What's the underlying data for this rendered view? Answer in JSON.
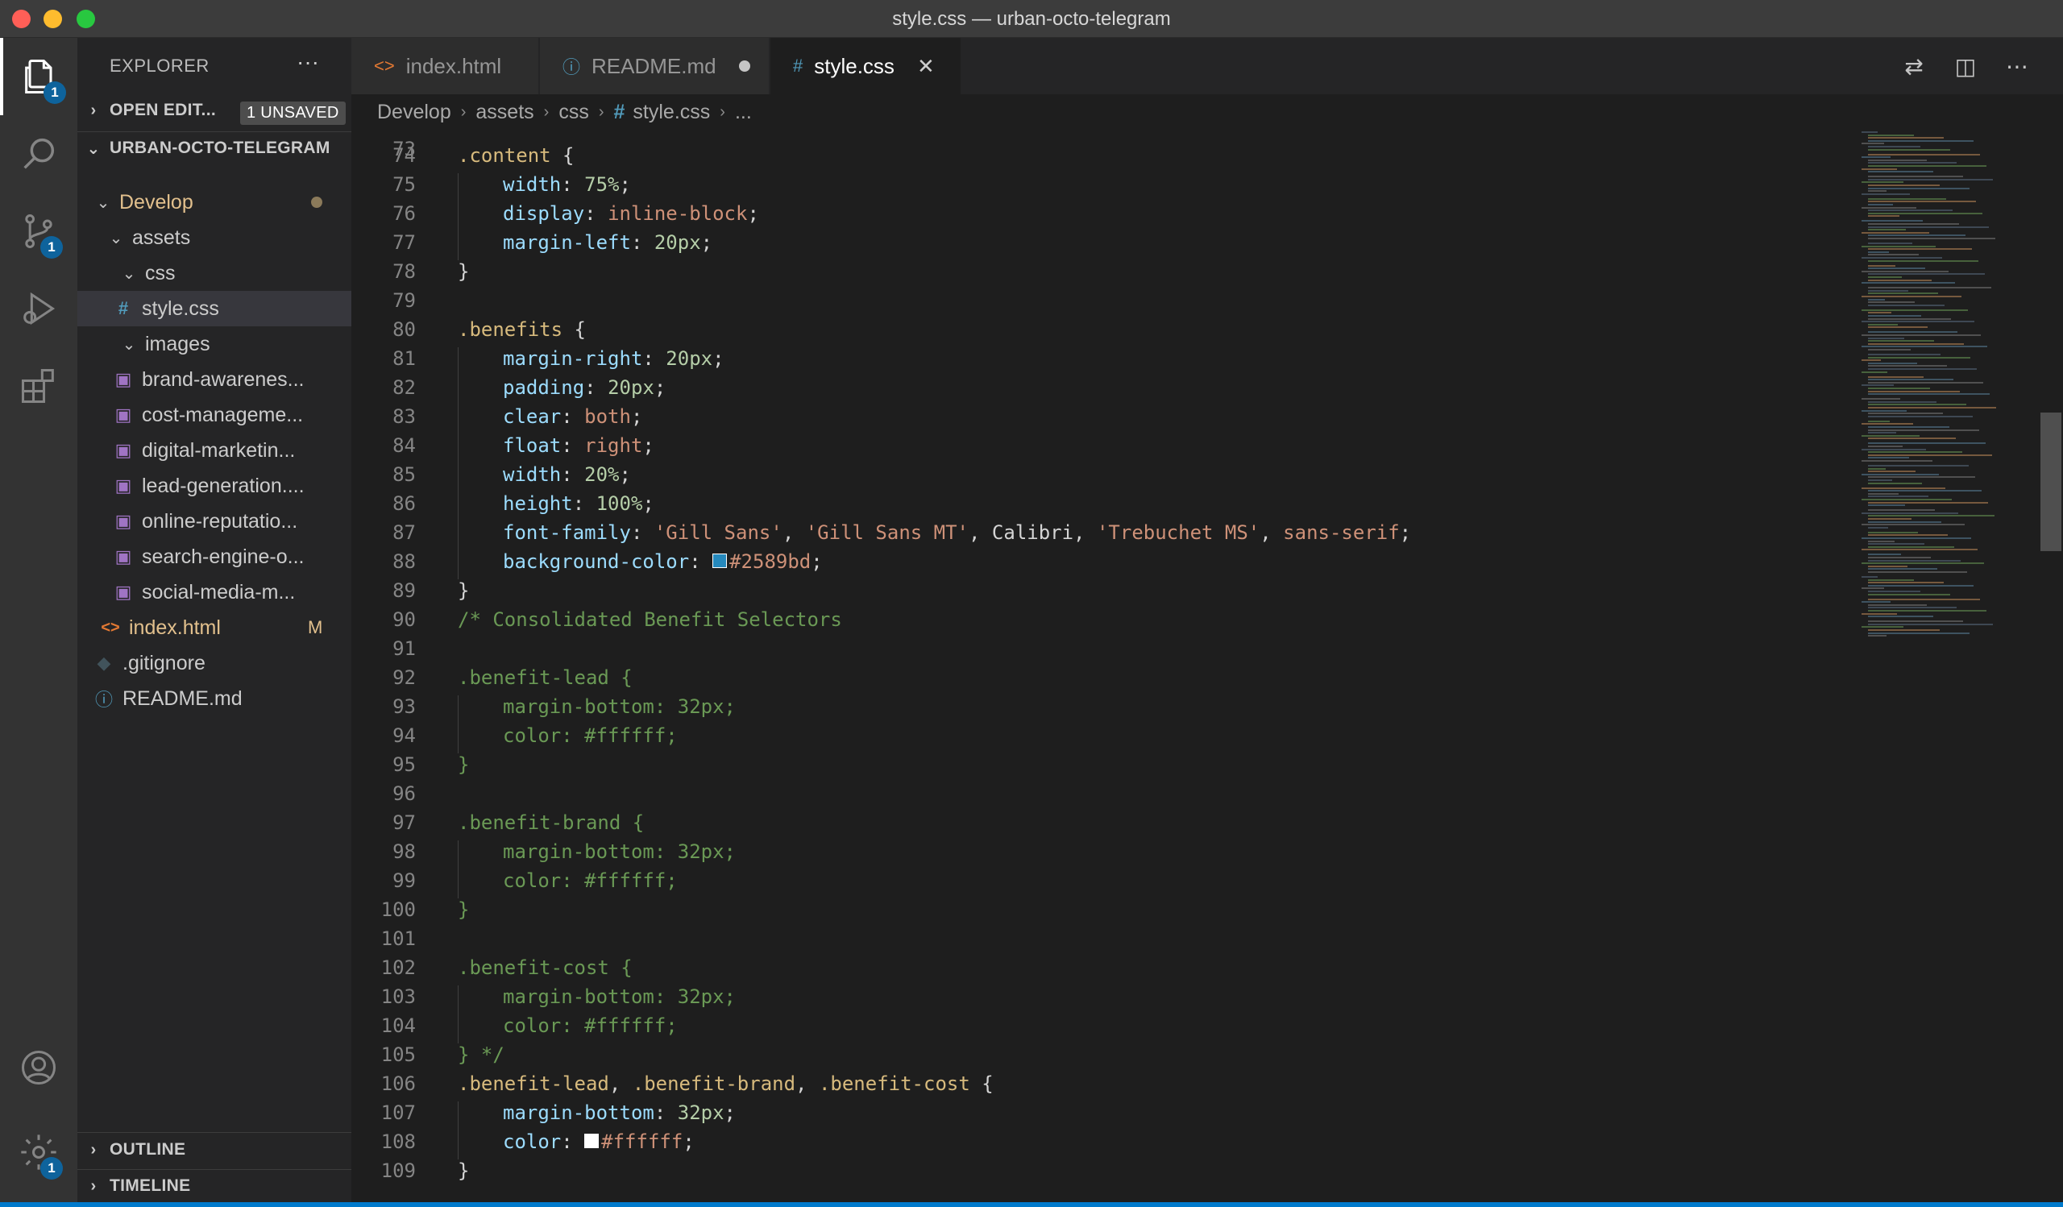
{
  "window": {
    "title": "style.css — urban-octo-telegram"
  },
  "activity_bar": {
    "explorer_badge": "1",
    "scm_badge": "1",
    "settings_badge": "1"
  },
  "explorer": {
    "header": "EXPLORER",
    "more": "···",
    "open_editors": {
      "label": "OPEN EDIT...",
      "badge": "1 UNSAVED"
    },
    "project": "URBAN-OCTO-TELEGRAM",
    "tree": [
      {
        "label": "Develop",
        "kind": "folder",
        "depth": 1,
        "expanded": true,
        "modified": true
      },
      {
        "label": "assets",
        "kind": "folder",
        "depth": 2,
        "expanded": true
      },
      {
        "label": "css",
        "kind": "folder",
        "depth": 3,
        "expanded": true
      },
      {
        "label": "style.css",
        "kind": "css",
        "depth": 4,
        "selected": true
      },
      {
        "label": "images",
        "kind": "folder",
        "depth": 3,
        "expanded": true
      },
      {
        "label": "brand-awarenes...",
        "kind": "image",
        "depth": 4
      },
      {
        "label": "cost-manageme...",
        "kind": "image",
        "depth": 4
      },
      {
        "label": "digital-marketin...",
        "kind": "image",
        "depth": 4
      },
      {
        "label": "lead-generation....",
        "kind": "image",
        "depth": 4
      },
      {
        "label": "online-reputatio...",
        "kind": "image",
        "depth": 4
      },
      {
        "label": "search-engine-o...",
        "kind": "image",
        "depth": 4
      },
      {
        "label": "social-media-m...",
        "kind": "image",
        "depth": 4
      },
      {
        "label": "index.html",
        "kind": "html",
        "depth": 2,
        "git": "M"
      },
      {
        "label": ".gitignore",
        "kind": "git",
        "depth": 1
      },
      {
        "label": "README.md",
        "kind": "info",
        "depth": 1
      }
    ],
    "outline": "OUTLINE",
    "timeline": "TIMELINE"
  },
  "tabs": [
    {
      "label": "index.html",
      "icon": "<>",
      "state": "normal"
    },
    {
      "label": "README.md",
      "icon": "ⓘ",
      "state": "dirty"
    },
    {
      "label": "style.css",
      "icon": "#",
      "state": "active"
    }
  ],
  "breadcrumb": [
    "Develop",
    "assets",
    "css",
    "style.css",
    "..."
  ],
  "code": {
    "top_line": "73",
    "lines": [
      {
        "n": "74",
        "tokens": [
          [
            "sel",
            ".content"
          ],
          [
            "pun",
            " {"
          ]
        ]
      },
      {
        "n": "75",
        "indent": true,
        "tokens": [
          [
            "prop",
            "width"
          ],
          [
            "pun",
            ": "
          ],
          [
            "num",
            "75%"
          ],
          [
            "pun",
            ";"
          ]
        ]
      },
      {
        "n": "76",
        "indent": true,
        "tokens": [
          [
            "prop",
            "display"
          ],
          [
            "pun",
            ": "
          ],
          [
            "kw",
            "inline-block"
          ],
          [
            "pun",
            ";"
          ]
        ]
      },
      {
        "n": "77",
        "indent": true,
        "tokens": [
          [
            "prop",
            "margin-left"
          ],
          [
            "pun",
            ": "
          ],
          [
            "num",
            "20px"
          ],
          [
            "pun",
            ";"
          ]
        ]
      },
      {
        "n": "78",
        "tokens": [
          [
            "pun",
            "}"
          ]
        ]
      },
      {
        "n": "79",
        "tokens": []
      },
      {
        "n": "80",
        "tokens": [
          [
            "sel",
            ".benefits"
          ],
          [
            "pun",
            " {"
          ]
        ]
      },
      {
        "n": "81",
        "indent": true,
        "tokens": [
          [
            "prop",
            "margin-right"
          ],
          [
            "pun",
            ": "
          ],
          [
            "num",
            "20px"
          ],
          [
            "pun",
            ";"
          ]
        ]
      },
      {
        "n": "82",
        "indent": true,
        "tokens": [
          [
            "prop",
            "padding"
          ],
          [
            "pun",
            ": "
          ],
          [
            "num",
            "20px"
          ],
          [
            "pun",
            ";"
          ]
        ]
      },
      {
        "n": "83",
        "indent": true,
        "tokens": [
          [
            "prop",
            "clear"
          ],
          [
            "pun",
            ": "
          ],
          [
            "kw",
            "both"
          ],
          [
            "pun",
            ";"
          ]
        ]
      },
      {
        "n": "84",
        "indent": true,
        "tokens": [
          [
            "prop",
            "float"
          ],
          [
            "pun",
            ": "
          ],
          [
            "kw",
            "right"
          ],
          [
            "pun",
            ";"
          ]
        ]
      },
      {
        "n": "85",
        "indent": true,
        "tokens": [
          [
            "prop",
            "width"
          ],
          [
            "pun",
            ": "
          ],
          [
            "num",
            "20%"
          ],
          [
            "pun",
            ";"
          ]
        ]
      },
      {
        "n": "86",
        "indent": true,
        "tokens": [
          [
            "prop",
            "height"
          ],
          [
            "pun",
            ": "
          ],
          [
            "num",
            "100%"
          ],
          [
            "pun",
            ";"
          ]
        ]
      },
      {
        "n": "87",
        "indent": true,
        "tokens": [
          [
            "prop",
            "font-family"
          ],
          [
            "pun",
            ": "
          ],
          [
            "str",
            "'Gill Sans'"
          ],
          [
            "pun",
            ", "
          ],
          [
            "str",
            "'Gill Sans MT'"
          ],
          [
            "pun",
            ", Calibri, "
          ],
          [
            "str",
            "'Trebuchet MS'"
          ],
          [
            "pun",
            ", "
          ],
          [
            "kw",
            "sans-serif"
          ],
          [
            "pun",
            ";"
          ]
        ]
      },
      {
        "n": "88",
        "indent": true,
        "tokens": [
          [
            "prop",
            "background-color"
          ],
          [
            "pun",
            ": "
          ],
          [
            "swatch",
            "#2589bd"
          ],
          [
            "kw",
            "#2589bd"
          ],
          [
            "pun",
            ";"
          ]
        ]
      },
      {
        "n": "89",
        "tokens": [
          [
            "pun",
            "}"
          ]
        ]
      },
      {
        "n": "90",
        "tokens": [
          [
            "com",
            "/* Consolidated Benefit Selectors"
          ]
        ]
      },
      {
        "n": "91",
        "tokens": []
      },
      {
        "n": "92",
        "tokens": [
          [
            "com",
            ".benefit-lead {"
          ]
        ]
      },
      {
        "n": "93",
        "indent": true,
        "tokens": [
          [
            "com",
            "margin-bottom: 32px;"
          ]
        ]
      },
      {
        "n": "94",
        "indent": true,
        "tokens": [
          [
            "com",
            "color: #ffffff;"
          ]
        ]
      },
      {
        "n": "95",
        "tokens": [
          [
            "com",
            "}"
          ]
        ]
      },
      {
        "n": "96",
        "tokens": []
      },
      {
        "n": "97",
        "tokens": [
          [
            "com",
            ".benefit-brand {"
          ]
        ]
      },
      {
        "n": "98",
        "indent": true,
        "tokens": [
          [
            "com",
            "margin-bottom: 32px;"
          ]
        ]
      },
      {
        "n": "99",
        "indent": true,
        "tokens": [
          [
            "com",
            "color: #ffffff;"
          ]
        ]
      },
      {
        "n": "100",
        "tokens": [
          [
            "com",
            "}"
          ]
        ]
      },
      {
        "n": "101",
        "tokens": []
      },
      {
        "n": "102",
        "tokens": [
          [
            "com",
            ".benefit-cost {"
          ]
        ]
      },
      {
        "n": "103",
        "indent": true,
        "tokens": [
          [
            "com",
            "margin-bottom: 32px;"
          ]
        ]
      },
      {
        "n": "104",
        "indent": true,
        "tokens": [
          [
            "com",
            "color: #ffffff;"
          ]
        ]
      },
      {
        "n": "105",
        "tokens": [
          [
            "com",
            "} */"
          ]
        ]
      },
      {
        "n": "106",
        "tokens": [
          [
            "sel",
            ".benefit-lead"
          ],
          [
            "pun",
            ", "
          ],
          [
            "sel",
            ".benefit-brand"
          ],
          [
            "pun",
            ", "
          ],
          [
            "sel",
            ".benefit-cost"
          ],
          [
            "pun",
            " {"
          ]
        ]
      },
      {
        "n": "107",
        "indent": true,
        "tokens": [
          [
            "prop",
            "margin-bottom"
          ],
          [
            "pun",
            ": "
          ],
          [
            "num",
            "32px"
          ],
          [
            "pun",
            ";"
          ]
        ]
      },
      {
        "n": "108",
        "indent": true,
        "tokens": [
          [
            "prop",
            "color"
          ],
          [
            "pun",
            ": "
          ],
          [
            "swatch",
            "#ffffff"
          ],
          [
            "kw",
            "#ffffff"
          ],
          [
            "pun",
            ";"
          ]
        ]
      },
      {
        "n": "109",
        "tokens": [
          [
            "pun",
            "}"
          ]
        ]
      }
    ]
  },
  "colors": {
    "accent": "#007acc",
    "badge": "#0e639c",
    "modified": "#e2c08d",
    "css_icon": "#519aba"
  }
}
